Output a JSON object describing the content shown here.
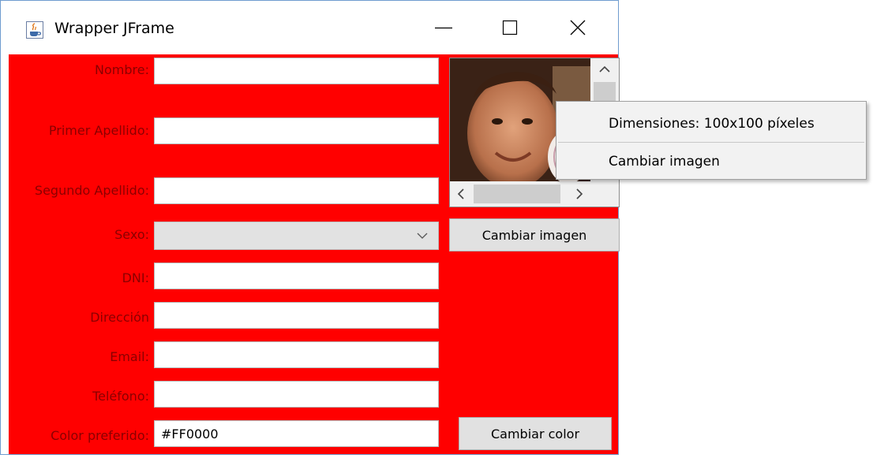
{
  "window": {
    "title": "Wrapper JFrame",
    "icon": "java-cup-icon",
    "controls": [
      "minimize-icon",
      "maximize-icon",
      "close-icon"
    ]
  },
  "form": {
    "nombre_label": "Nombre:",
    "nombre_value": "",
    "primer_apellido_label": "Primer Apellido:",
    "primer_apellido_value": "",
    "segundo_apellido_label": "Segundo Apellido:",
    "segundo_apellido_value": "",
    "sexo_label": "Sexo:",
    "sexo_value": "",
    "dni_label": "DNI:",
    "dni_value": "",
    "direccion_label": "Dirección",
    "direccion_value": "",
    "email_label": "Email:",
    "email_value": "",
    "telefono_label": "Teléfono:",
    "telefono_value": "",
    "color_label": "Color preferido:",
    "color_value": "#FF0000"
  },
  "buttons": {
    "cambiar_imagen": "Cambiar imagen",
    "cambiar_color": "Cambiar color"
  },
  "context_menu": {
    "items": [
      "Dimensiones: 100x100 píxeles",
      "Cambiar imagen"
    ]
  },
  "colors": {
    "panel_background": "#ff0000",
    "label_text": "#8a0000"
  }
}
